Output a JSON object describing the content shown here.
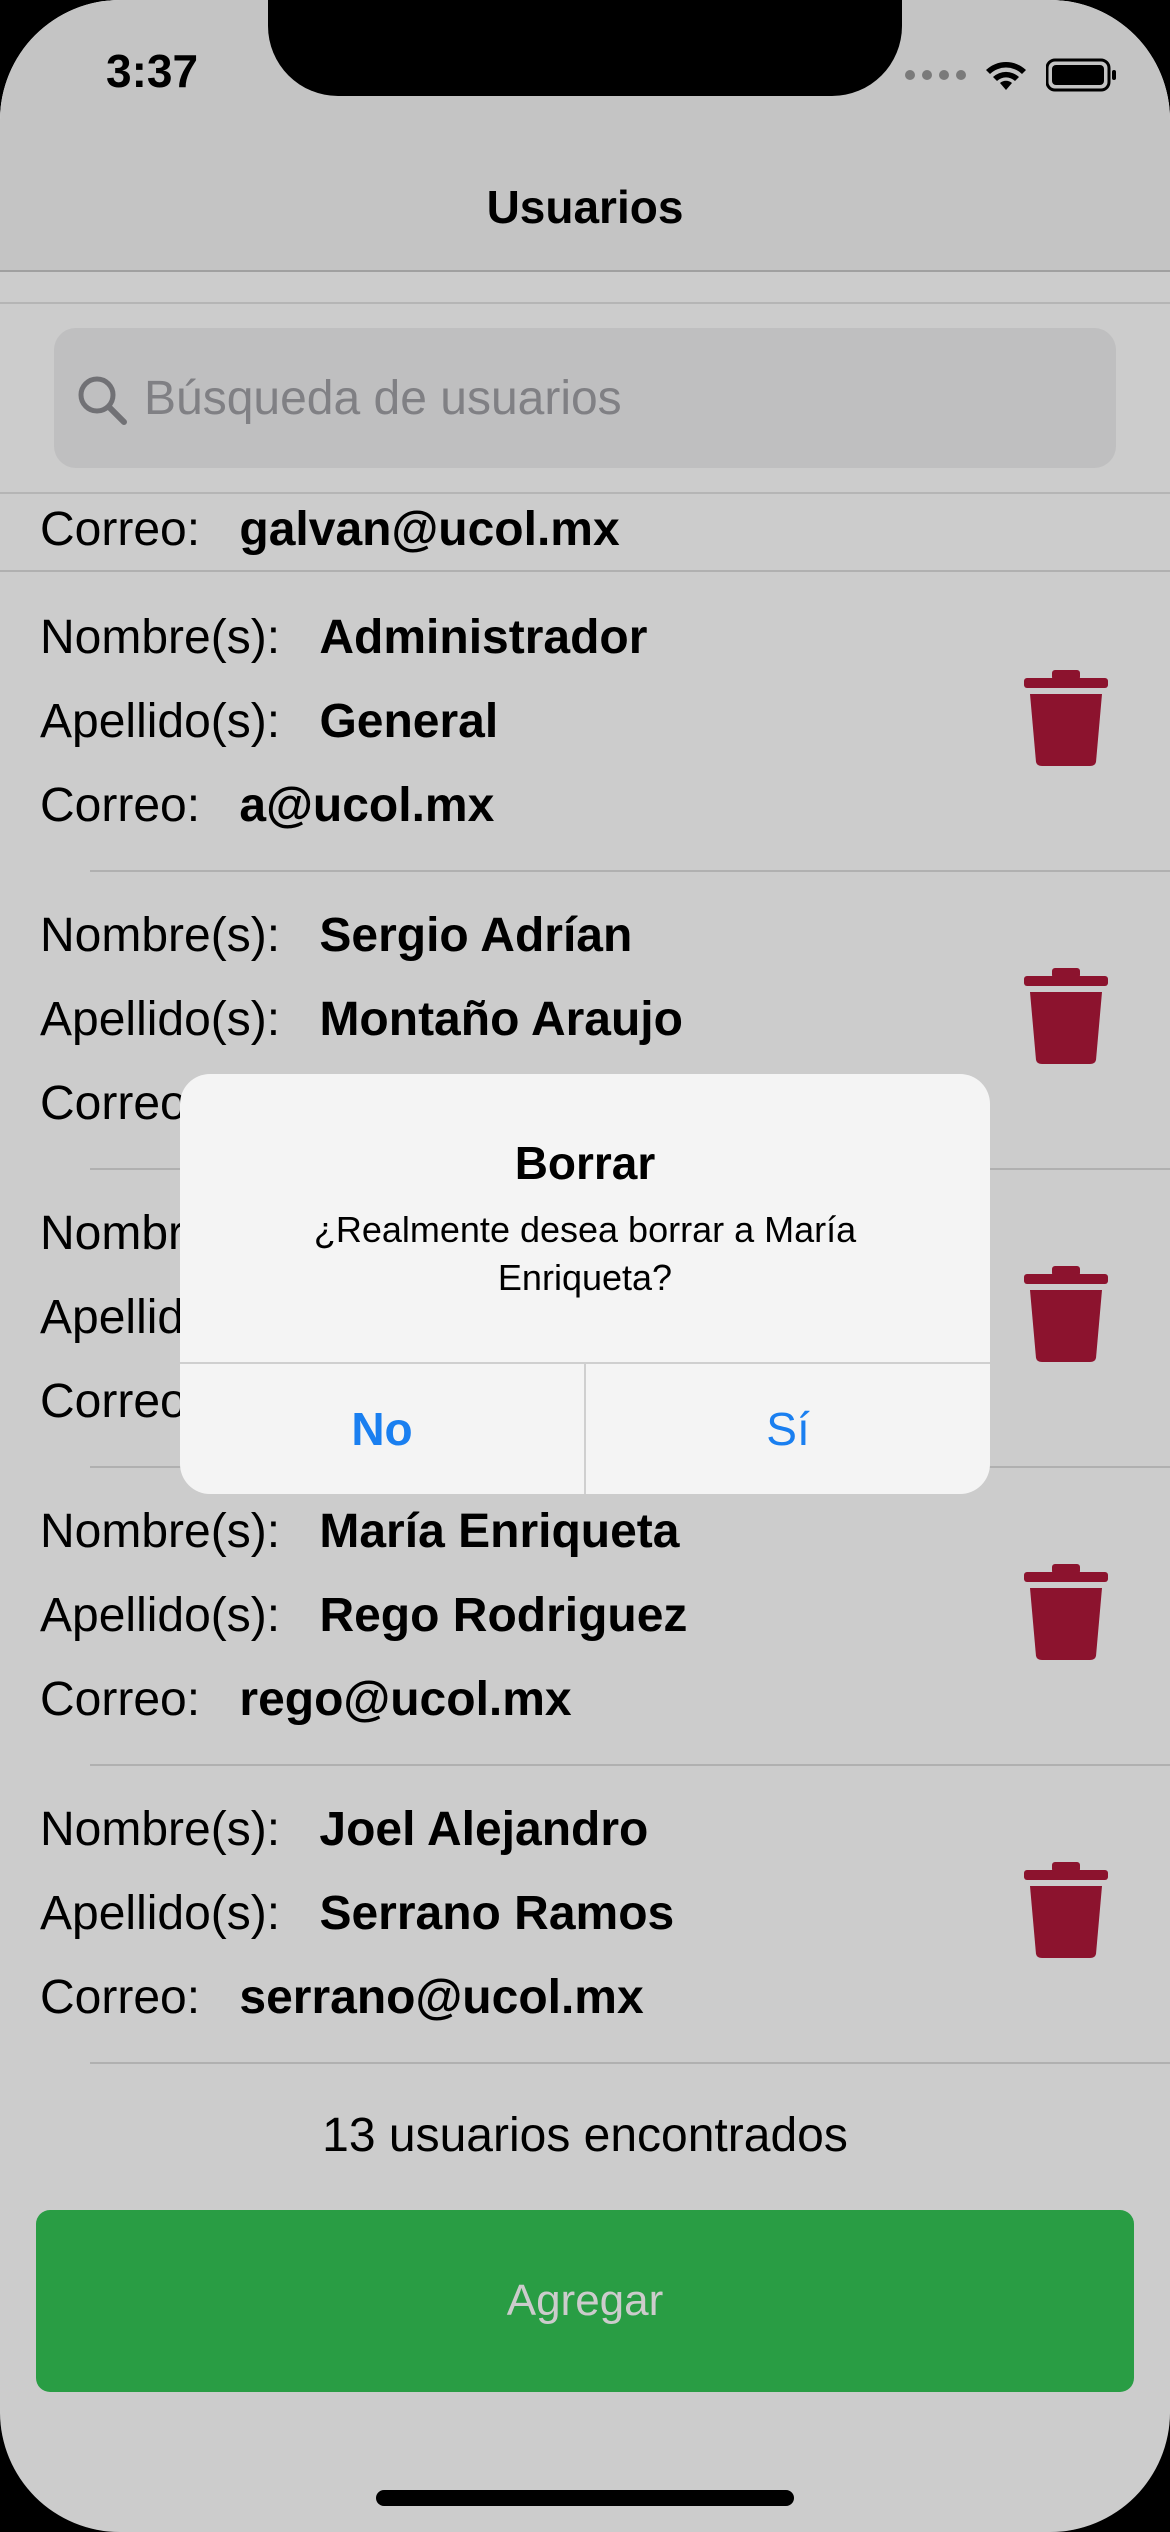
{
  "status_bar": {
    "time": "3:37"
  },
  "nav": {
    "title": "Usuarios"
  },
  "search": {
    "placeholder": "Búsqueda de usuarios",
    "value": ""
  },
  "labels": {
    "nombre": "Nombre(s):",
    "apellido": "Apellido(s):",
    "correo": "Correo:"
  },
  "partial_row": {
    "correo": "galvan@ucol.mx"
  },
  "users": [
    {
      "nombre": "Administrador",
      "apellido": "General",
      "correo": "a@ucol.mx"
    },
    {
      "nombre": "Sergio Adrían",
      "apellido": "Montaño Araujo",
      "correo": ""
    },
    {
      "nombre": "",
      "apellido": "",
      "correo": ""
    },
    {
      "nombre": "María Enriqueta",
      "apellido": "Rego Rodriguez",
      "correo": "rego@ucol.mx"
    },
    {
      "nombre": "Joel Alejandro",
      "apellido": "Serrano Ramos",
      "correo": "serrano@ucol.mx"
    }
  ],
  "footer": {
    "count_text": "13 usuarios encontrados",
    "add_label": "Agregar"
  },
  "alert": {
    "title": "Borrar",
    "message": "¿Realmente desea borrar a María Enriqueta?",
    "no_label": "No",
    "yes_label": "Sí"
  },
  "colors": {
    "accent": "#1a7ff0",
    "trash": "#b0183a",
    "add_button": "#34c556"
  }
}
